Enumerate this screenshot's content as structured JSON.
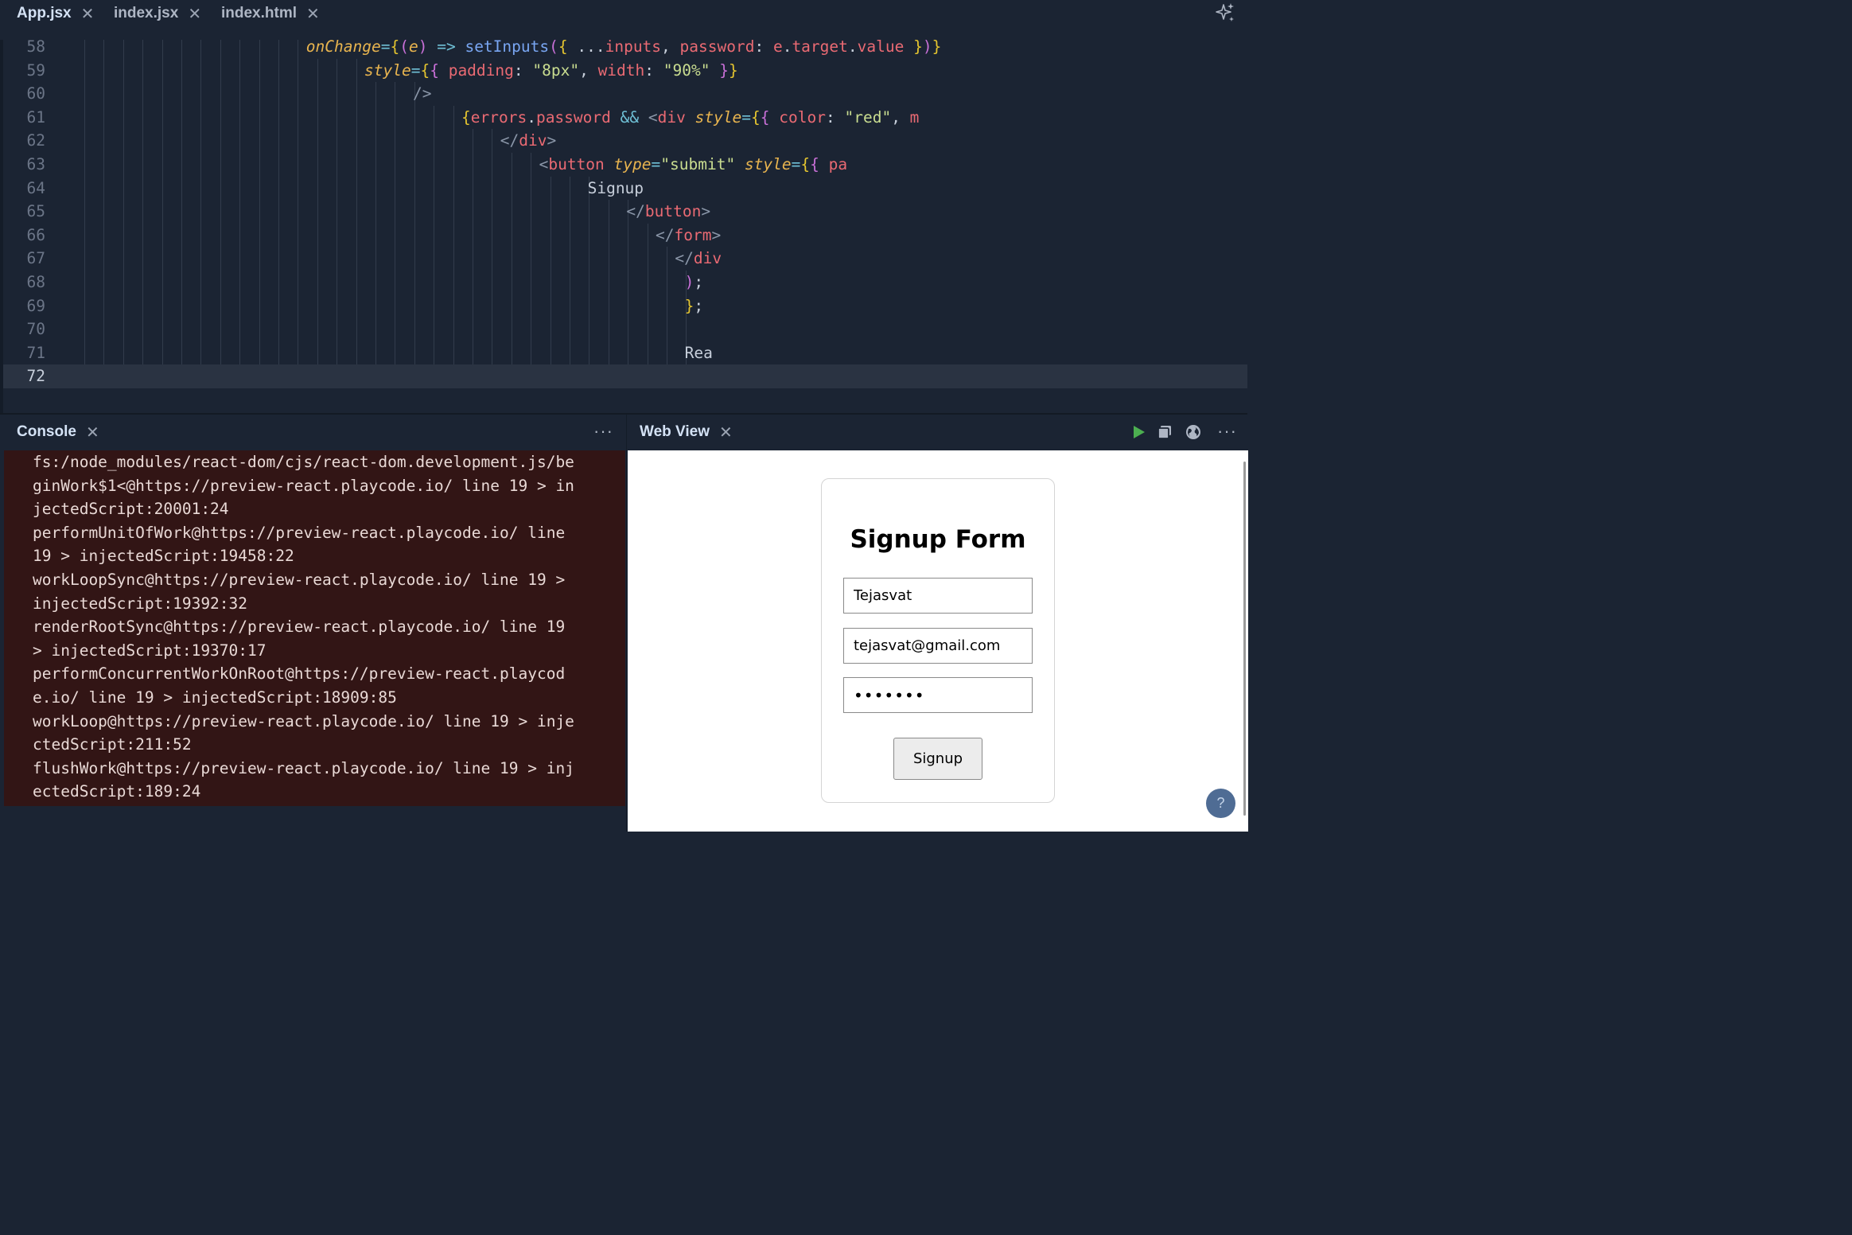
{
  "editor": {
    "tabs": [
      {
        "label": "App.jsx",
        "active": true
      },
      {
        "label": "index.jsx",
        "active": false
      },
      {
        "label": "index.html",
        "active": false
      }
    ],
    "close_glyph": "✕",
    "ai_icon": "sparkle-icon",
    "lines": [
      {
        "num": "58",
        "indent": 24,
        "guides": 24,
        "tokens": [
          [
            "t-attr",
            "onChange"
          ],
          [
            "t-pun",
            "="
          ],
          [
            "t-br",
            "{"
          ],
          [
            "t-par",
            "("
          ],
          [
            "t-attr",
            "e"
          ],
          [
            "t-par",
            ")"
          ],
          [
            "t-txt",
            " "
          ],
          [
            "t-pun",
            "=>"
          ],
          [
            "t-txt",
            " "
          ],
          [
            "t-fn",
            "setInputs"
          ],
          [
            "t-par",
            "("
          ],
          [
            "t-br",
            "{"
          ],
          [
            "t-txt",
            " ..."
          ],
          [
            "t-var",
            "inputs"
          ],
          [
            "t-txt",
            ", "
          ],
          [
            "t-key",
            "password"
          ],
          [
            "t-txt",
            ": "
          ],
          [
            "t-var",
            "e"
          ],
          [
            "t-txt",
            "."
          ],
          [
            "t-var",
            "target"
          ],
          [
            "t-txt",
            "."
          ],
          [
            "t-var",
            "value"
          ],
          [
            "t-txt",
            " "
          ],
          [
            "t-br",
            "}"
          ],
          [
            "t-par",
            ")"
          ],
          [
            "t-br",
            "}"
          ]
        ]
      },
      {
        "num": "59",
        "indent": 30,
        "guides": 30,
        "tokens": [
          [
            "t-attr",
            "style"
          ],
          [
            "t-pun",
            "="
          ],
          [
            "t-br",
            "{"
          ],
          [
            "t-br2",
            "{"
          ],
          [
            "t-txt",
            " "
          ],
          [
            "t-key",
            "padding"
          ],
          [
            "t-txt",
            ": "
          ],
          [
            "t-str",
            "\"8px\""
          ],
          [
            "t-txt",
            ", "
          ],
          [
            "t-key",
            "width"
          ],
          [
            "t-txt",
            ": "
          ],
          [
            "t-str",
            "\"90%\""
          ],
          [
            "t-txt",
            " "
          ],
          [
            "t-br2",
            "}"
          ],
          [
            "t-br",
            "}"
          ]
        ]
      },
      {
        "num": "60",
        "indent": 35,
        "guides": 35,
        "tokens": [
          [
            "t-ang",
            "/>"
          ]
        ]
      },
      {
        "num": "61",
        "indent": 40,
        "guides": 40,
        "tokens": [
          [
            "t-br",
            "{"
          ],
          [
            "t-var",
            "errors"
          ],
          [
            "t-txt",
            "."
          ],
          [
            "t-var",
            "password"
          ],
          [
            "t-txt",
            " "
          ],
          [
            "t-pun",
            "&&"
          ],
          [
            "t-txt",
            " "
          ],
          [
            "t-ang",
            "<"
          ],
          [
            "t-tag",
            "div"
          ],
          [
            "t-txt",
            " "
          ],
          [
            "t-attr",
            "style"
          ],
          [
            "t-pun",
            "="
          ],
          [
            "t-br",
            "{"
          ],
          [
            "t-br2",
            "{"
          ],
          [
            "t-txt",
            " "
          ],
          [
            "t-key",
            "color"
          ],
          [
            "t-txt",
            ": "
          ],
          [
            "t-str",
            "\"red\""
          ],
          [
            "t-txt",
            ", "
          ],
          [
            "t-key",
            "m"
          ]
        ]
      },
      {
        "num": "62",
        "indent": 44,
        "guides": 44,
        "tokens": [
          [
            "t-ang",
            "</"
          ],
          [
            "t-tag",
            "div"
          ],
          [
            "t-ang",
            ">"
          ]
        ]
      },
      {
        "num": "63",
        "indent": 48,
        "guides": 48,
        "tokens": [
          [
            "t-ang",
            "<"
          ],
          [
            "t-tag",
            "button"
          ],
          [
            "t-txt",
            " "
          ],
          [
            "t-attr",
            "type"
          ],
          [
            "t-pun",
            "="
          ],
          [
            "t-str",
            "\"submit\""
          ],
          [
            "t-txt",
            " "
          ],
          [
            "t-attr",
            "style"
          ],
          [
            "t-pun",
            "="
          ],
          [
            "t-br",
            "{"
          ],
          [
            "t-br2",
            "{"
          ],
          [
            "t-txt",
            " "
          ],
          [
            "t-key",
            "pa"
          ]
        ]
      },
      {
        "num": "64",
        "indent": 53,
        "guides": 53,
        "tokens": [
          [
            "t-txt",
            "Signup"
          ]
        ]
      },
      {
        "num": "65",
        "indent": 57,
        "guides": 57,
        "tokens": [
          [
            "t-ang",
            "</"
          ],
          [
            "t-tag",
            "button"
          ],
          [
            "t-ang",
            ">"
          ]
        ]
      },
      {
        "num": "66",
        "indent": 60,
        "guides": 60,
        "tokens": [
          [
            "t-ang",
            "</"
          ],
          [
            "t-tag",
            "form"
          ],
          [
            "t-ang",
            ">"
          ]
        ]
      },
      {
        "num": "67",
        "indent": 62,
        "guides": 62,
        "tokens": [
          [
            "t-ang",
            "</"
          ],
          [
            "t-tag",
            "div"
          ]
        ]
      },
      {
        "num": "68",
        "indent": 63,
        "guides": 63,
        "tokens": [
          [
            "t-par",
            ")"
          ],
          [
            "t-txt",
            ";"
          ]
        ]
      },
      {
        "num": "69",
        "indent": 63,
        "guides": 63,
        "tokens": [
          [
            "t-br",
            "}"
          ],
          [
            "t-txt",
            ";"
          ]
        ]
      },
      {
        "num": "70",
        "indent": 63,
        "guides": 63,
        "tokens": []
      },
      {
        "num": "71",
        "indent": 63,
        "guides": 63,
        "tokens": [
          [
            "t-txt",
            "Rea"
          ]
        ]
      },
      {
        "num": "72",
        "indent": 0,
        "guides": 0,
        "current": true,
        "tokens": []
      }
    ]
  },
  "console": {
    "title": "Console",
    "more": "···",
    "lines": [
      "fs:/node_modules/react-dom/cjs/react-dom.development.js/be",
      "ginWork$1<@https://preview-react.playcode.io/ line 19 > in",
      "jectedScript:20001:24",
      "performUnitOfWork@https://preview-react.playcode.io/ line",
      "19 > injectedScript:19458:22",
      "workLoopSync@https://preview-react.playcode.io/ line 19 >",
      "injectedScript:19392:32",
      "renderRootSync@https://preview-react.playcode.io/ line 19",
      "> injectedScript:19370:17",
      "performConcurrentWorkOnRoot@https://preview-react.playcod",
      "e.io/ line 19 > injectedScript:18909:85",
      "workLoop@https://preview-react.playcode.io/ line 19 > inje",
      "ctedScript:211:52",
      "flushWork@https://preview-react.playcode.io/ line 19 > inj",
      "ectedScript:189:24"
    ]
  },
  "webview": {
    "title": "Web View",
    "more": "···",
    "toolbar_icons": [
      "play-icon",
      "window-icon",
      "globe-icon"
    ],
    "colors": {
      "play": "#4caf50"
    },
    "form": {
      "title": "Signup Form",
      "name_value": "Tejasvat",
      "email_value": "tejasvat@gmail.com",
      "password_value": "•••••••",
      "button_label": "Signup"
    },
    "help_label": "?"
  }
}
